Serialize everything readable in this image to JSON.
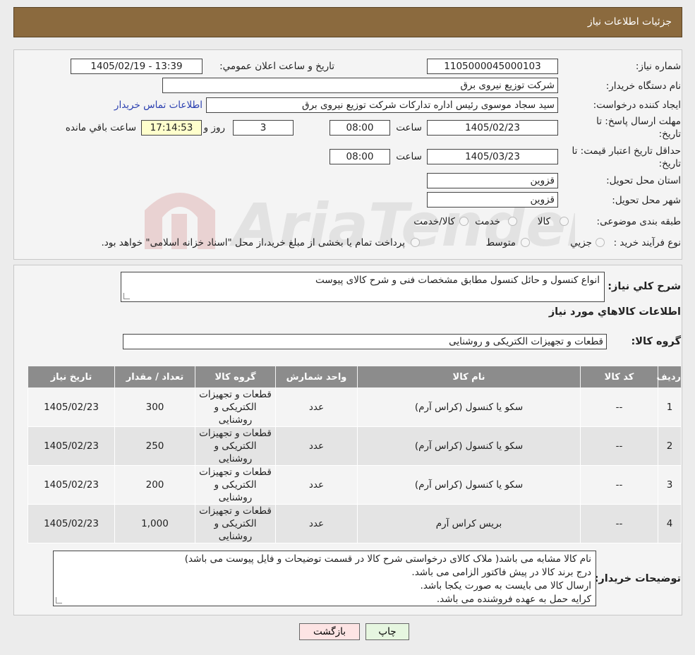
{
  "header": {
    "title": "جزئیات اطلاعات نیاز"
  },
  "form": {
    "need_number_label": "شماره نیاز:",
    "need_number": "1105000045000103",
    "announce_label": "تاريخ و ساعت اعلان عمومي:",
    "announce_value": "1405/02/19 - 13:39",
    "buyer_org_label": "نام دستگاه خریدار:",
    "buyer_org": "شرکت توزیع نیروی برق",
    "creator_label": "ایجاد کننده درخواست:",
    "creator": "سید سجاد موسوی رئیس اداره تدارکات شرکت توزیع نیروی برق",
    "contact_link": "اطلاعات تماس خریدار",
    "deadline_label_1": "مهلت ارسال پاسخ: تا",
    "deadline_label_2": "تاریخ:",
    "deadline_date": "1405/02/23",
    "time_label": "ساعت",
    "deadline_time": "08:00",
    "days_value": "3",
    "days_label": "روز و",
    "remaining_time": "17:14:53",
    "remaining_label": "ساعت باقي مانده",
    "validity_label_1": "حداقل تاریخ اعتبار قیمت: تا",
    "validity_label_2": "تاریخ:",
    "validity_date": "1405/03/23",
    "validity_time": "08:00",
    "province_label": "استان محل تحویل:",
    "province": "قزوین",
    "city_label": "شهر محل تحویل:",
    "city": "قزوین",
    "category_label": "طبقه بندی موضوعی:",
    "category_options": [
      "کالا",
      "خدمت",
      "کالا/خدمت"
    ],
    "purchase_type_label": "نوع فرآیند خرید :",
    "purchase_options": [
      "جزیي",
      "متوسط"
    ],
    "purchase_note": "پرداخت تمام یا بخشی از مبلغ خرید،از محل \"اسناد خزانه اسلامی\" خواهد بود."
  },
  "summary": {
    "label": "شرح کلي نياز:",
    "value": "انواع کنسول  و حائل کنسول مطابق مشخصات فنی  و شرح کالای پیوست",
    "items_heading": "اطلاعات کالاهاي مورد نياز",
    "group_label": "گروه کالا:",
    "group_value": "قطعات و تجهیزات الکتریکی و روشنایی"
  },
  "table": {
    "headers": [
      "ردیف",
      "کد کالا",
      "نام کالا",
      "واحد شمارش",
      "گروه کالا",
      "تعداد / مقدار",
      "تاریخ نیاز"
    ],
    "rows": [
      [
        "1",
        "--",
        "سکو یا کنسول (کراس آرم)",
        "عدد",
        "قطعات و تجهیزات الکتریکی و روشنایی",
        "300",
        "1405/02/23"
      ],
      [
        "2",
        "--",
        "سکو یا کنسول (کراس آرم)",
        "عدد",
        "قطعات و تجهیزات الکتریکی و روشنایی",
        "250",
        "1405/02/23"
      ],
      [
        "3",
        "--",
        "سکو یا کنسول (کراس آرم)",
        "عدد",
        "قطعات و تجهیزات الکتریکی و روشنایی",
        "200",
        "1405/02/23"
      ],
      [
        "4",
        "--",
        "بریس کراس آرم",
        "عدد",
        "قطعات و تجهیزات الکتریکی و روشنایی",
        "1,000",
        "1405/02/23"
      ]
    ]
  },
  "notes": {
    "label": "توضیحات خریدار:",
    "lines": [
      "نام کالا مشابه می باشد( ملاک کالای درخواستی شرح کالا در قسمت توضیحات و فایل پیوست می باشد)",
      "درج برند کالا در پیش فاکتور الزامی می باشد.",
      "ارسال کالا می بایست به صورت یکجا باشد.",
      "کرایه حمل به عهده فروشنده می باشد."
    ]
  },
  "buttons": {
    "print": "چاپ",
    "back": "بازگشت"
  },
  "watermark": {
    "text": "AriaTender.neT"
  }
}
